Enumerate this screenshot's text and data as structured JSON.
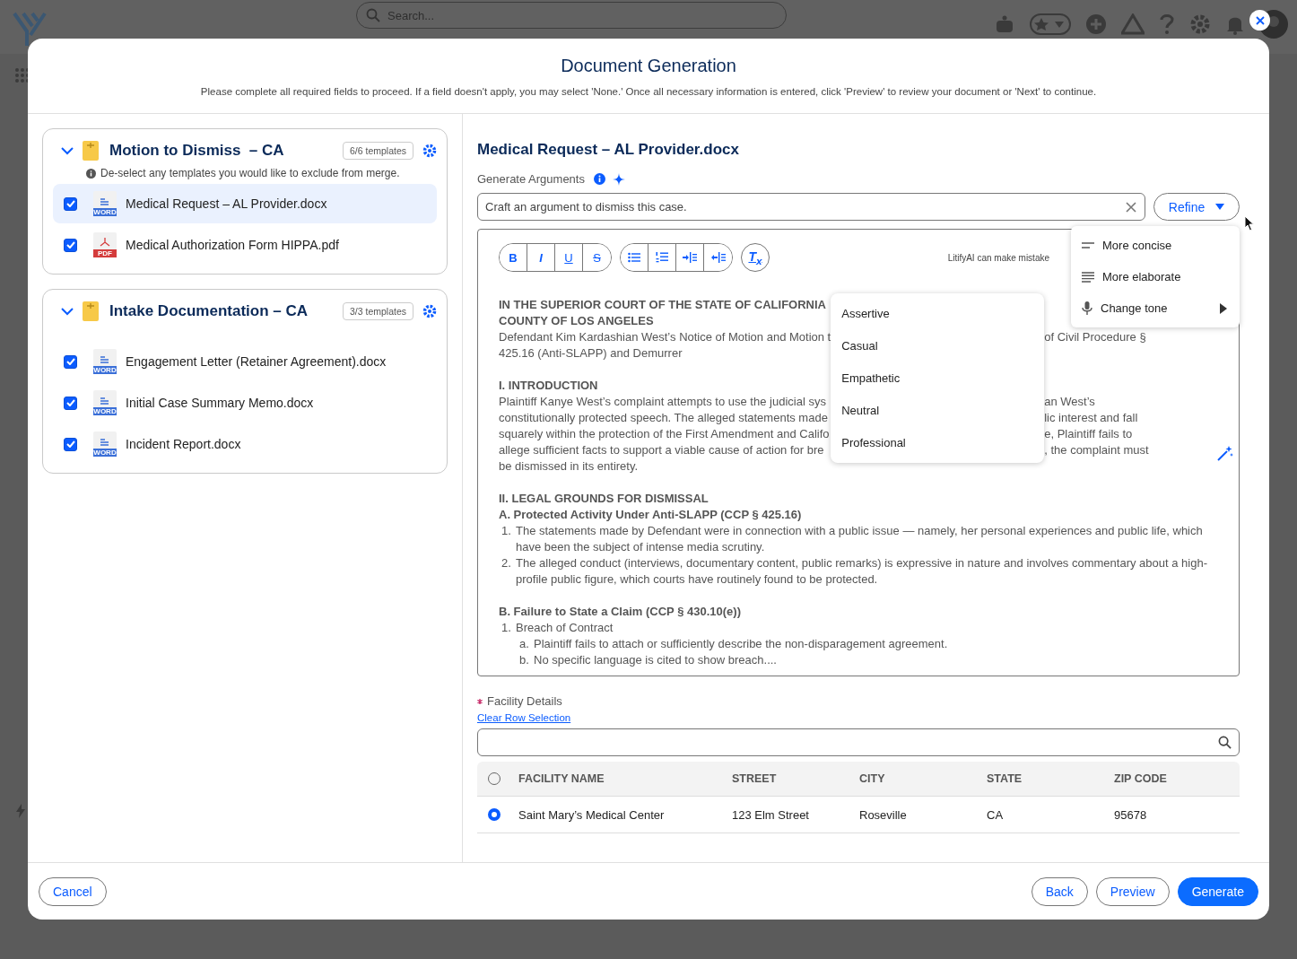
{
  "background": {
    "search": {
      "placeholder": "Search..."
    }
  },
  "modal": {
    "title": "Document Generation",
    "instructions": "Please complete all required fields to proceed. If a field doesn't apply, you may select 'None.' Once all necessary information is entered, click 'Preview' to review your document or 'Next' to continue."
  },
  "template_groups": [
    {
      "title": "Motion to Dismiss  – CA",
      "count": "6/6 templates",
      "expanded": true,
      "note": "De-select any templates you would like to exclude from merge.",
      "templates": [
        {
          "name": "Medical Request – AL Provider.docx",
          "kind": "text-file",
          "badge": "WORD",
          "checked": true,
          "selected": true
        },
        {
          "name": "Medical Authorization Form HIPPA.pdf",
          "kind": "acrobat-file",
          "badge": "PDF",
          "checked": true,
          "selected": false
        }
      ]
    },
    {
      "title": "Intake Documentation – CA",
      "count": "3/3 templates",
      "expanded": true,
      "templates": [
        {
          "name": "Engagement Letter (Retainer Agreement).docx",
          "kind": "text-file",
          "badge": "WORD",
          "checked": true,
          "selected": false
        },
        {
          "name": "Initial Case Summary Memo.docx",
          "kind": "text-file",
          "badge": "WORD",
          "checked": true,
          "selected": false
        },
        {
          "name": "Incident Report.docx",
          "kind": "text-file",
          "badge": "WORD",
          "checked": true,
          "selected": false
        }
      ]
    }
  ],
  "editor": {
    "title": "Medical Request – AL Provider.docx",
    "generate_label": "Generate Arguments",
    "prompt": {
      "value": "Craft an argument to dismiss this case."
    },
    "refine_button": "Refine",
    "format_buttons": [
      {
        "kind": "bold",
        "label": "B"
      },
      {
        "kind": "italic",
        "label": "I"
      },
      {
        "kind": "underline",
        "label": "U"
      },
      {
        "kind": "strike",
        "label": "S"
      }
    ],
    "clear_format": "T$_{x}$",
    "disclaimer": "LitifyAI can make mistake",
    "covered_lines": [
      {
        "kind": "heading",
        "left": "IN THE SUPERIOR COURT OF THE STATE OF CALIFORNIA"
      },
      {
        "kind": "heading",
        "left": "COUNTY OF LOS ANGELES"
      },
      {
        "kind": "text",
        "left": "Defendant Kim Kardashian West’s Notice of Motion and Motion t",
        "right": "of Civil Procedure §"
      },
      {
        "kind": "text",
        "left": "425.16 (Anti-SLAPP) and Demurrer"
      },
      {
        "kind": "blank"
      },
      {
        "kind": "heading",
        "left": "I. INTRODUCTION"
      },
      {
        "kind": "text",
        "left": "Plaintiff Kanye West’s complaint attempts to use the judicial sys",
        "right": "an West’s"
      },
      {
        "kind": "text",
        "left": "constitutionally protected speech. The alleged statements made",
        "right": "lic interest and fall"
      },
      {
        "kind": "text",
        "left": "squarely within the protection of the First Amendment and Califo",
        "right": "e, Plaintiff fails to"
      },
      {
        "kind": "text",
        "left": "allege sufficient facts to support a viable cause of action for bre",
        "right": ", the complaint must"
      },
      {
        "kind": "text",
        "left": "be dismissed in its entirety."
      }
    ],
    "lines": [
      {
        "kind": "blank"
      },
      {
        "kind": "heading",
        "text": "II. LEGAL GROUNDS FOR DISMISSAL"
      },
      {
        "kind": "subheading",
        "text": "A. Protected Activity Under Anti-SLAPP (CCP § 425.16)"
      },
      {
        "kind": "item",
        "marker": "1.",
        "text": "The statements made by Defendant were in connection with a public issue — namely, her personal experiences and public life, which have been the subject of intense media scrutiny."
      },
      {
        "kind": "item",
        "marker": "2.",
        "text": "The alleged conduct (interviews, documentary content, public remarks) is expressive in nature and involves commentary about a high-profile public figure, which courts have routinely found to be protected."
      },
      {
        "kind": "blank"
      },
      {
        "kind": "subheading",
        "text": "B. Failure to State a Claim (CCP § 430.10(e))"
      },
      {
        "kind": "item",
        "marker": "1.",
        "text": "Breach of Contract"
      },
      {
        "kind": "subitem",
        "marker": "a.",
        "text": "Plaintiff fails to attach or sufficiently describe the non-disparagement agreement."
      },
      {
        "kind": "subitem",
        "marker": "b.",
        "text": "No specific language is cited to show breach...."
      }
    ],
    "refine_menu": [
      {
        "label": "More concise",
        "kind": "concise"
      },
      {
        "label": "More elaborate",
        "kind": "elaborate"
      },
      {
        "label": "Change tone",
        "kind": "tone"
      }
    ],
    "tone_menu": [
      "Assertive",
      "Casual",
      "Empathetic",
      "Neutral",
      "Professional"
    ]
  },
  "facility": {
    "label": "Facility Details",
    "required": true,
    "clear_link": "Clear Row Selection",
    "columns": [
      "FACILITY NAME",
      "STREET",
      "CITY",
      "STATE",
      "ZIP CODE"
    ],
    "all_selected": false,
    "rows": [
      {
        "cells": [
          "Saint Mary’s Medical Center",
          "123 Elm Street",
          "Roseville",
          "CA",
          "95678"
        ],
        "selected": true
      }
    ]
  },
  "footer": {
    "left": [
      {
        "label": "Cancel",
        "kind": "secondary"
      }
    ],
    "right": [
      {
        "label": "Back",
        "kind": "secondary"
      },
      {
        "label": "Preview",
        "kind": "secondary"
      },
      {
        "label": "Generate",
        "kind": "primary"
      }
    ]
  }
}
